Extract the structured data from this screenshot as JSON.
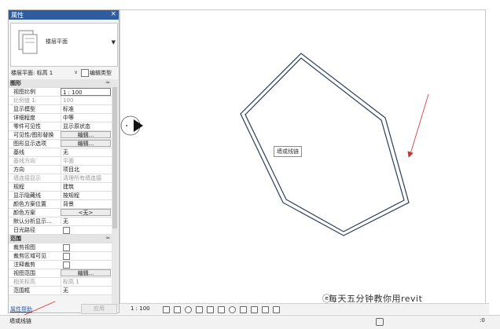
{
  "properties": {
    "title": "属性",
    "close_glyph": "×",
    "type_name": "楼层平面",
    "instance_label": "楼层平面: 标高 1",
    "edit_type_label": "编辑类型",
    "rows": [
      {
        "kind": "group",
        "label": "图形",
        "toggle": "≈"
      },
      {
        "kind": "input",
        "key": "视图比例",
        "value": "1 : 100"
      },
      {
        "kind": "text",
        "key": "比例值 1:",
        "value": "100",
        "dim": true
      },
      {
        "kind": "text",
        "key": "显示模型",
        "value": "标准"
      },
      {
        "kind": "text",
        "key": "详细程度",
        "value": "中等"
      },
      {
        "kind": "text",
        "key": "零件可见性",
        "value": "显示原状态"
      },
      {
        "kind": "button",
        "key": "可见性/图形替换",
        "value": "编辑..."
      },
      {
        "kind": "button",
        "key": "图形显示选项",
        "value": "编辑..."
      },
      {
        "kind": "text",
        "key": "基线",
        "value": "无"
      },
      {
        "kind": "text",
        "key": "基线方向",
        "value": "平面",
        "dim": true
      },
      {
        "kind": "text",
        "key": "方向",
        "value": "项目北"
      },
      {
        "kind": "text",
        "key": "墙连接显示",
        "value": "清理所有墙连接",
        "dim": true
      },
      {
        "kind": "text",
        "key": "规程",
        "value": "建筑"
      },
      {
        "kind": "text",
        "key": "显示隐藏线",
        "value": "按规程"
      },
      {
        "kind": "text",
        "key": "颜色方案位置",
        "value": "背景"
      },
      {
        "kind": "button",
        "key": "颜色方案",
        "value": "<无>"
      },
      {
        "kind": "text",
        "key": "默认分析显示...",
        "value": "无"
      },
      {
        "kind": "checkbox",
        "key": "日光路径"
      },
      {
        "kind": "group",
        "label": "范围",
        "toggle": "≈"
      },
      {
        "kind": "checkbox",
        "key": "裁剪视图"
      },
      {
        "kind": "checkbox",
        "key": "裁剪区域可见"
      },
      {
        "kind": "checkbox",
        "key": "注释裁剪"
      },
      {
        "kind": "button",
        "key": "视图范围",
        "value": "编辑..."
      },
      {
        "kind": "text",
        "key": "相关标高",
        "value": "标高 1",
        "dim": true
      },
      {
        "kind": "text",
        "key": "范围框",
        "value": "无"
      }
    ],
    "help_link": "属性帮助",
    "apply_label": "应用"
  },
  "canvas": {
    "tooltip": "墙或线链"
  },
  "viewbar": {
    "scale": "1 : 100"
  },
  "statusbar": {
    "text": "墙或线链",
    "zero": ":0"
  },
  "watermark": {
    "icon": "ⓔ",
    "text": "每天五分钟教你用revit"
  },
  "colors": {
    "title_bar": "#2f5c9e",
    "wall_line": "#2a3c5c",
    "annotation_red": "#d23030"
  }
}
